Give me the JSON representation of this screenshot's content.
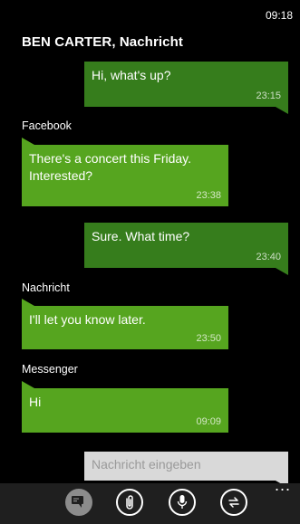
{
  "status": {
    "time": "09:18"
  },
  "thread": {
    "title": "BEN CARTER, Nachricht"
  },
  "messages": [
    {
      "direction": "out",
      "text": "Hi, what's up?",
      "time": "23:15"
    },
    {
      "direction": "in",
      "source": "Facebook",
      "text": "There's a concert this Friday. Interested?",
      "time": "23:38"
    },
    {
      "direction": "out",
      "text": "Sure. What time?",
      "time": "23:40"
    },
    {
      "direction": "in",
      "source": "Nachricht",
      "text": "I'll let you know later.",
      "time": "23:50"
    },
    {
      "direction": "in",
      "source": "Messenger",
      "text": "Hi",
      "time": "09:09"
    }
  ],
  "compose": {
    "placeholder": "Nachricht eingeben"
  },
  "appbar": {
    "icons": [
      "switch-conversation-icon",
      "attach-icon",
      "voice-icon",
      "swap-icon"
    ],
    "more": "..."
  },
  "colors": {
    "outgoing": "#367d1c",
    "incoming": "#56a51f",
    "background": "#000000",
    "compose": "#d9d9d9"
  }
}
